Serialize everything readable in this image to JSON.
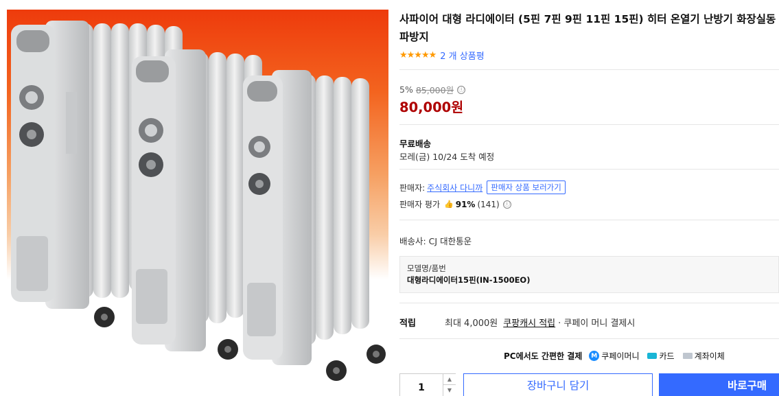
{
  "product": {
    "title": "사파이어 대형 라디에이터 (5핀 7핀 9핀 11핀 15핀) 히터 온열기 난방기 화장실동파방지",
    "image_alt": "Three grey oil-filled radiator heaters on an orange gradient background"
  },
  "rating": {
    "stars": "★★★★★",
    "review_count_label": "2 개 상품평"
  },
  "price": {
    "discount_rate": "5%",
    "original_price": "85,000원",
    "info_icon": "ⓘ",
    "sale_price": "80,000원"
  },
  "shipping": {
    "free_label": "무료배송",
    "arrival": "모레(금) 10/24 도착 예정"
  },
  "seller": {
    "label": "판매자:",
    "name": "주식회사 다니까",
    "view_products_button": "판매자 상품 보러가기",
    "rating_label": "판매자 평가",
    "rating_icon": "thumbs-up-icon",
    "rating_percent": "91%",
    "rating_count": "(141)"
  },
  "courier": {
    "text": "배송사:  CJ 대한통운"
  },
  "model": {
    "label": "모델명/품번",
    "value": "대형라디에이터15핀(IN-1500EO)"
  },
  "points": {
    "label": "적립",
    "max": "최대 4,000원",
    "link": "쿠팡캐시 적립",
    "rest": "· 쿠페이 머니 결제시"
  },
  "payment": {
    "title": "PC에서도 간편한 결제",
    "coupay_icon": "M",
    "coupay": "쿠페이머니",
    "card": "카드",
    "bank": "계좌이체"
  },
  "purchase": {
    "quantity": "1",
    "up_arrow": "▲",
    "down_arrow": "▼",
    "cart_button": "장바구니 담기",
    "buy_button": "바로구매"
  },
  "colors": {
    "accent_blue": "#346aff",
    "sale_red": "#ae0000",
    "star_orange": "#ff9900",
    "hero_orange": "#ee3b0c"
  }
}
